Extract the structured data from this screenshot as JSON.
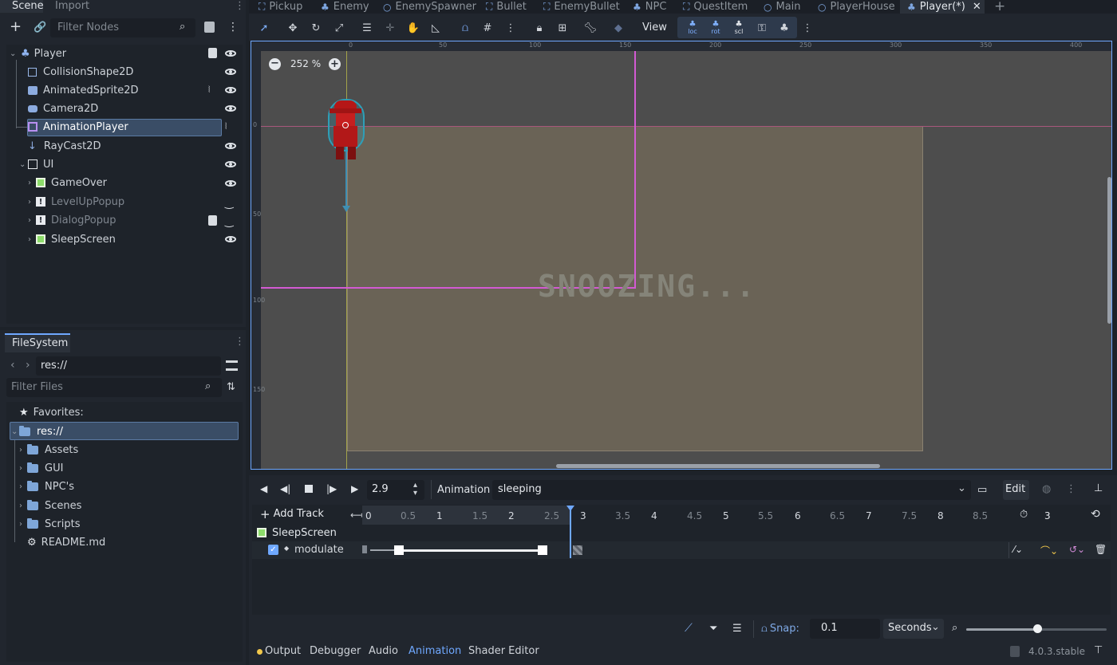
{
  "scene_dock": {
    "tabs": [
      "Scene",
      "Import"
    ],
    "filter_placeholder": "Filter Nodes",
    "nodes": [
      {
        "label": "Player",
        "icon": "player-node-icon"
      },
      {
        "label": "CollisionShape2D",
        "icon": "collision-shape-icon"
      },
      {
        "label": "AnimatedSprite2D",
        "icon": "animated-sprite-icon"
      },
      {
        "label": "Camera2D",
        "icon": "camera-icon"
      },
      {
        "label": "AnimationPlayer",
        "icon": "animation-player-icon"
      },
      {
        "label": "RayCast2D",
        "icon": "raycast-icon"
      },
      {
        "label": "UI",
        "icon": "ui-node-icon"
      },
      {
        "label": "GameOver",
        "icon": "control-icon"
      },
      {
        "label": "LevelUpPopup",
        "icon": "warning-icon"
      },
      {
        "label": "DialogPopup",
        "icon": "warning-icon"
      },
      {
        "label": "SleepScreen",
        "icon": "control-icon"
      }
    ]
  },
  "filesystem": {
    "tab": "FileSystem",
    "path": "res://",
    "filter_placeholder": "Filter Files",
    "favorites_label": "Favorites:",
    "root": "res://",
    "items": [
      "Assets",
      "GUI",
      "NPC's",
      "Scenes",
      "Scripts",
      "README.md"
    ]
  },
  "editor_tabs": [
    "Pickup",
    "Enemy",
    "EnemySpawner",
    "Bullet",
    "EnemyBullet",
    "NPC",
    "QuestItem",
    "Main",
    "PlayerHouse",
    "Player(*)"
  ],
  "toolbar": {
    "view_label": "View",
    "zoom": "252 %",
    "transform_labels": [
      "loc",
      "rot",
      "scl"
    ]
  },
  "rulers": {
    "top": [
      "0",
      "50",
      "100",
      "150",
      "200",
      "250",
      "300",
      "350",
      "400"
    ],
    "left": [
      "0",
      "50",
      "100",
      "150"
    ]
  },
  "canvas": {
    "overlay_text": "SNOOZING..."
  },
  "animation_panel": {
    "time_value": "2.9",
    "animation_label": "Animation",
    "animation_name": "sleeping",
    "edit_label": "Edit",
    "add_track_label": "Add Track",
    "timeline_numbers": [
      "0",
      "0.5",
      "1",
      "1.5",
      "2",
      "2.5",
      "3",
      "3.5",
      "4",
      "4.5",
      "5",
      "5.5",
      "6",
      "6.5",
      "7",
      "7.5",
      "8",
      "8.5"
    ],
    "length_value": "3",
    "track_group": "SleepScreen",
    "track_property": "modulate",
    "snap_label": "Snap:",
    "snap_value": "0.1",
    "snap_unit": "Seconds"
  },
  "bottom_bar": {
    "tabs": [
      "Output",
      "Debugger",
      "Audio",
      "Animation",
      "Shader Editor"
    ],
    "active_tab": "Animation",
    "version": "4.0.3.stable"
  },
  "colors": {
    "accent": "#6fa8ff",
    "selection": "#3a4d66",
    "canvas_bg": "#4d4d4d",
    "screen_rect": "#6a6356",
    "guide_pink": "#d35ad3",
    "player_red": "#c61f1f"
  }
}
